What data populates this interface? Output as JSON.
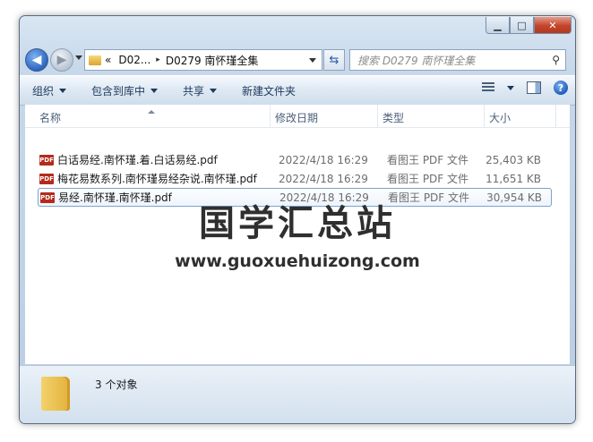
{
  "window": {
    "caption": {
      "minimize": "▁",
      "maximize": "□",
      "close": "✕"
    }
  },
  "nav": {
    "address": {
      "chevron": "«",
      "parent": "D02...",
      "separator": "▸",
      "current": "D0279 南怀瑾全集"
    },
    "search": {
      "placeholder": "搜索 D0279 南怀瑾全集"
    }
  },
  "toolbar": {
    "organize": "组织",
    "include_in_library": "包含到库中",
    "share": "共享",
    "new_folder": "新建文件夹"
  },
  "columns": {
    "name": "名称",
    "date": "修改日期",
    "type": "类型",
    "size": "大小"
  },
  "files": [
    {
      "name": "白话易经.南怀瑾.着.白话易经.pdf",
      "date": "2022/4/18 16:29",
      "type": "看图王 PDF 文件",
      "size": "25,403 KB"
    },
    {
      "name": "梅花易数系列.南怀瑾易经杂说.南怀瑾.pdf",
      "date": "2022/4/18 16:29",
      "type": "看图王 PDF 文件",
      "size": "11,651 KB"
    },
    {
      "name": "易经.南怀瑾.南怀瑾.pdf",
      "date": "2022/4/18 16:29",
      "type": "看图王 PDF 文件",
      "size": "30,954 KB"
    }
  ],
  "watermark": {
    "title": "国学汇总站",
    "url": "www.guoxuehuizong.com"
  },
  "status": {
    "count": "3 个对象"
  },
  "icons": {
    "file": "pdf-icon",
    "back": "back-arrow-icon",
    "forward": "forward-arrow-icon"
  }
}
